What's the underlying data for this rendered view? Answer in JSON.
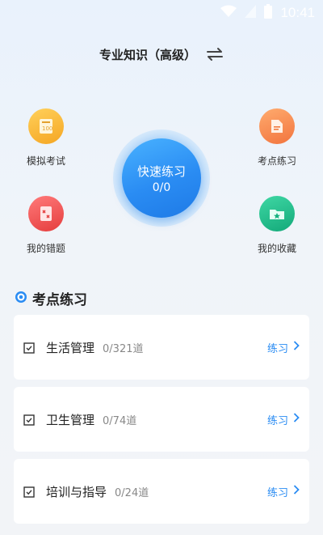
{
  "status_bar": {
    "time": "10:41"
  },
  "header": {
    "title": "专业知识（高级）"
  },
  "features": {
    "mock_exam": "模拟考试",
    "point_practice": "考点练习",
    "wrong_questions": "我的错题",
    "favorites": "我的收藏"
  },
  "quick_practice": {
    "label": "快速练习",
    "count": "0/0"
  },
  "section": {
    "title": "考点练习"
  },
  "topics": [
    {
      "name": "生活管理",
      "count": "0/321道",
      "action": "练习"
    },
    {
      "name": "卫生管理",
      "count": "0/74道",
      "action": "练习"
    },
    {
      "name": "培训与指导",
      "count": "0/24道",
      "action": "练习"
    }
  ],
  "colors": {
    "accent": "#2a8cf3",
    "mock_exam": "#f7b331",
    "point_practice": "#f7844a",
    "wrong_questions": "#ec4b4b",
    "favorites": "#1fb98c"
  }
}
